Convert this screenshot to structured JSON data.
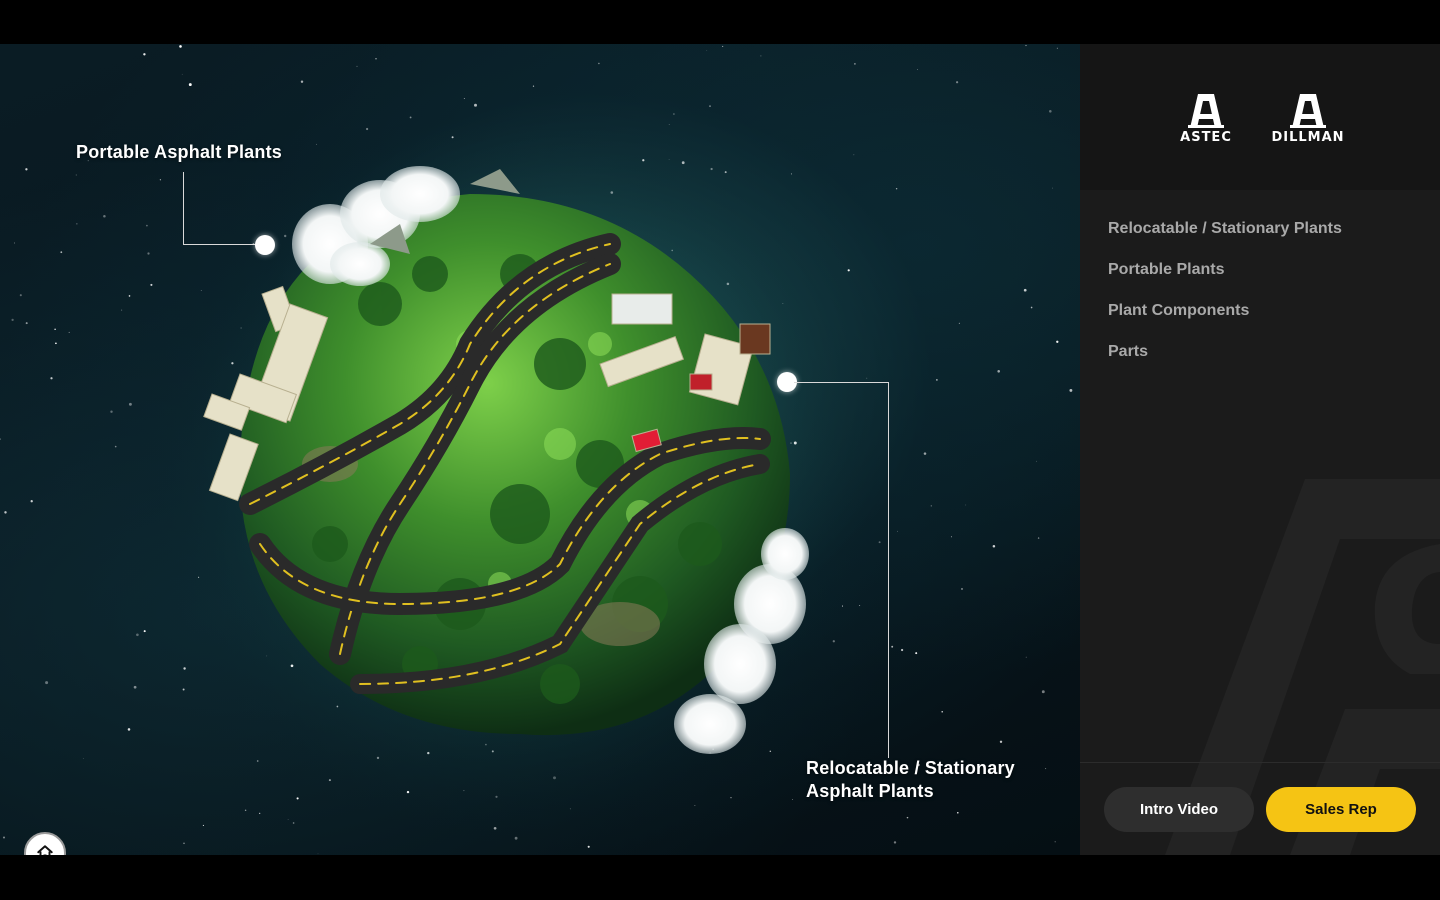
{
  "scene": {
    "callouts": [
      {
        "label": "Portable Asphalt Plants"
      },
      {
        "label_line1": "Relocatable / Stationary",
        "label_line2": "Asphalt Plants"
      }
    ],
    "home_icon": "home-icon"
  },
  "sidebar": {
    "logos": [
      {
        "name": "ASTEC"
      },
      {
        "name": "DILLMAN"
      }
    ],
    "nav_items": [
      {
        "label": "Relocatable / Stationary Plants"
      },
      {
        "label": "Portable Plants"
      },
      {
        "label": "Plant Components"
      },
      {
        "label": "Parts"
      }
    ],
    "buttons": {
      "intro_video": "Intro Video",
      "sales_rep": "Sales Rep"
    }
  },
  "colors": {
    "accent_yellow": "#f5c414",
    "sidebar_bg": "#1b1b1b",
    "header_bg": "#151515",
    "nav_text": "#a9a9a9"
  }
}
